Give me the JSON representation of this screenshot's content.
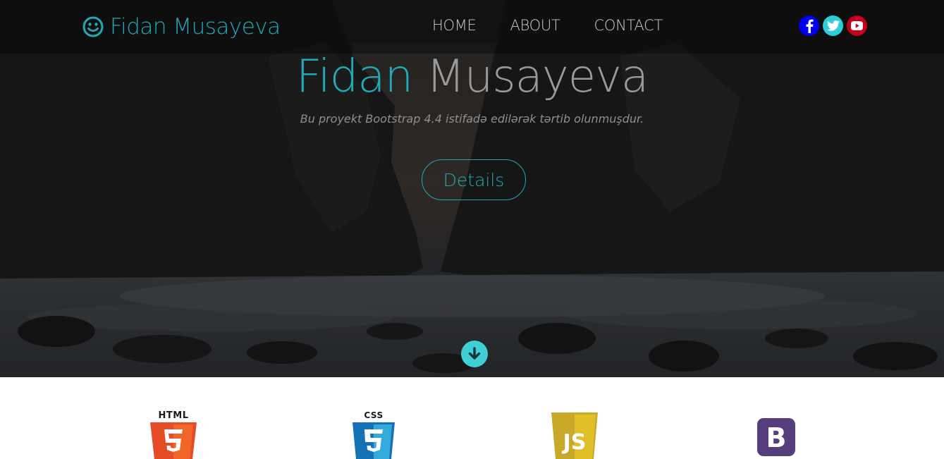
{
  "navbar": {
    "brand": "Fidan Musayeva",
    "brand_icon": "smile-icon",
    "links": [
      "HOME",
      "ABOUT",
      "CONTACT"
    ],
    "social": [
      {
        "name": "facebook-icon",
        "color": "#0000ee"
      },
      {
        "name": "twitter-icon",
        "color": "#2ccfd9"
      },
      {
        "name": "youtube-icon",
        "color": "#c4001b"
      }
    ]
  },
  "hero": {
    "title_first": "Fidan",
    "title_last": "Musayeva",
    "subtitle": "Bu proyekt Bootstrap 4.4 istifadə edilərək tərtib olunmuşdur.",
    "details_label": "Details",
    "scroll_icon": "arrow-down-circle-icon"
  },
  "technologies": {
    "html_label": "HTML",
    "css_label": "CSS",
    "js_label": "JS",
    "bootstrap_label": "B"
  },
  "colors": {
    "accent": "#20a9b8",
    "scroll": "#3ed0d6",
    "html": "#e44d26",
    "css": "#1572b6",
    "js": "#e0bf2b",
    "bootstrap": "#563d7c"
  }
}
